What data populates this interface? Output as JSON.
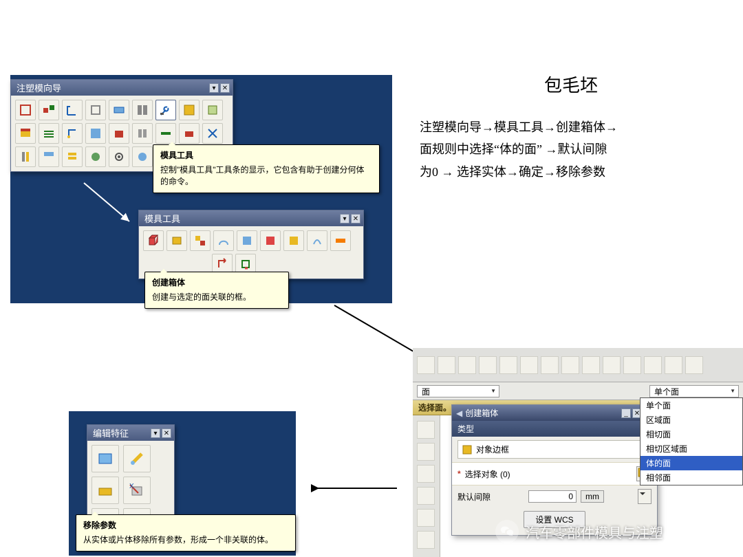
{
  "right_column": {
    "heading": "包毛坯",
    "flow_line1": "注塑模向导→模具工具→创建箱体→",
    "flow_line2": "面规则中选择“体的面” →默认间隙",
    "flow_line3": "为0 → 选择实体→确定→移除参数"
  },
  "panel_top": {
    "title": "注塑模向导",
    "tooltip": {
      "title": "模具工具",
      "body": "控制\"模具工具\"工具条的显示，它包含有助于创建分何体的命令。"
    }
  },
  "panel_moldtools": {
    "title": "模具工具",
    "tooltip": {
      "title": "创建箱体",
      "body": "创建与选定的面关联的框。"
    }
  },
  "panel_edit": {
    "title": "编辑特征",
    "tooltip": {
      "title": "移除参数",
      "body": "从实体或片体移除所有参数，形成一个非关联的体。"
    }
  },
  "dialog_area": {
    "filter_left_label": "面",
    "filter_right_label": "单个面",
    "selbar": "选择面。",
    "dialog_title": "创建箱体",
    "section_type": "类型",
    "type_value": "对象边框",
    "select_obj_label": "选择对象 (0)",
    "clearance_label": "默认间隙",
    "clearance_value": "0",
    "clearance_unit": "mm",
    "wcs_button": "设置 WCS",
    "dropdown": {
      "o1": "单个面",
      "o2": "区域面",
      "o3": "相切面",
      "o4": "相切区域面",
      "o5_selected": "体的面",
      "o6": "相邻面"
    }
  },
  "watermark": "汽车零部件模具与注塑",
  "glyph_close": "✕",
  "glyph_pin": "▾"
}
